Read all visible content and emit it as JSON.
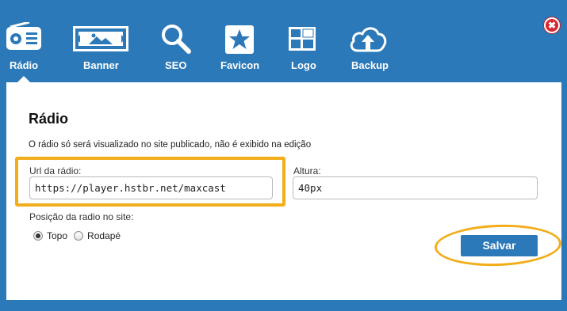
{
  "tabs": [
    {
      "label": "Rádio",
      "icon": "radio-icon",
      "active": true
    },
    {
      "label": "Banner",
      "icon": "image-icon",
      "active": false
    },
    {
      "label": "SEO",
      "icon": "search-icon",
      "active": false
    },
    {
      "label": "Favicon",
      "icon": "star-icon",
      "active": false
    },
    {
      "label": "Logo",
      "icon": "logo-icon",
      "active": false
    },
    {
      "label": "Backup",
      "icon": "cloud-upload-icon",
      "active": false
    }
  ],
  "close": {
    "glyph": "✖",
    "color": "#d8262f"
  },
  "panel": {
    "title": "Rádio",
    "description": "O rádio só será visualizado no site publicado, não é exibido na edição",
    "url_label": "Url da rádio:",
    "url_value": "https://player.hstbr.net/maxcast",
    "height_label": "Altura:",
    "height_value": "40px",
    "position_label": "Posição da radio no site:",
    "options": [
      {
        "label": "Topo",
        "checked": true
      },
      {
        "label": "Rodapé",
        "checked": false
      }
    ],
    "save_label": "Salvar"
  },
  "colors": {
    "background": "#2b79b8",
    "highlight": "#f2ad1a",
    "button": "#2b79b8"
  }
}
